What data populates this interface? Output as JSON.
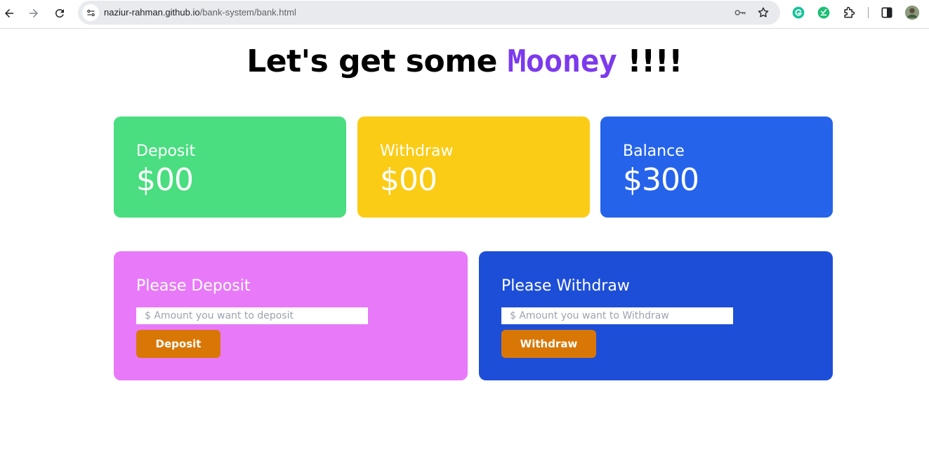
{
  "browser": {
    "url_domain": "naziur-rahman.github.io",
    "url_path": "/bank-system/bank.html",
    "icons": [
      "back-arrow-icon",
      "forward-arrow-icon",
      "reload-icon",
      "site-info-icon",
      "password-key-icon",
      "bookmark-star-icon",
      "grammarly-icon",
      "extension-green-icon",
      "extensions-puzzle-icon",
      "side-panel-icon",
      "profile-avatar-icon"
    ]
  },
  "headline": {
    "prefix": "Let's get some ",
    "highlight": "Mooney",
    "suffix": " !!!!",
    "highlight_color": "#7c3aed"
  },
  "stats": {
    "deposit": {
      "label": "Deposit",
      "value": "$00",
      "color": "#4ade80"
    },
    "withdraw": {
      "label": "Withdraw",
      "value": "$00",
      "color": "#facc15"
    },
    "balance": {
      "label": "Balance",
      "value": "$300",
      "color": "#2563eb"
    }
  },
  "deposit_form": {
    "title": "Please Deposit",
    "placeholder": "$ Amount you want to deposit",
    "button_label": "Deposit",
    "color": "#e879f9"
  },
  "withdraw_form": {
    "title": "Please Withdraw",
    "placeholder": "$ Amount you want to Withdraw",
    "button_label": "Withdraw",
    "color": "#1d4ed8"
  },
  "button_color": "#d97706"
}
